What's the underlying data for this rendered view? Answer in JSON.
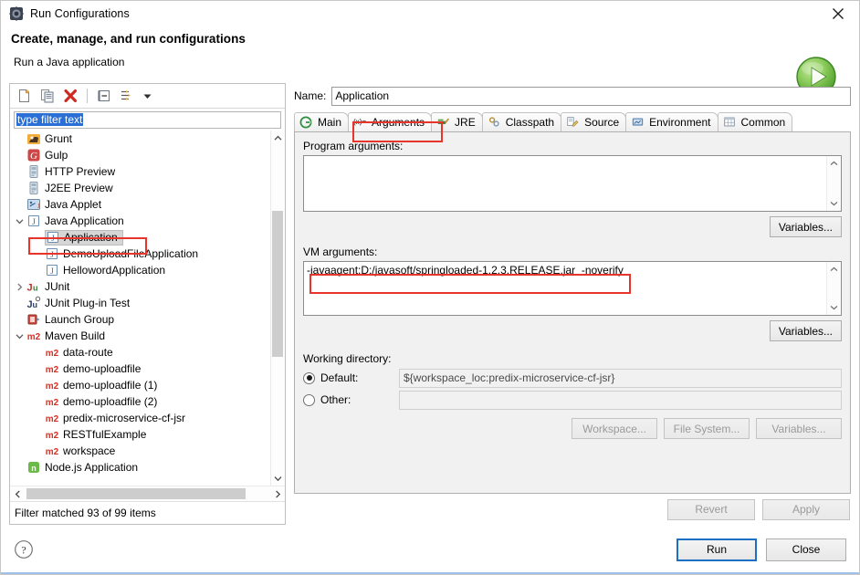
{
  "window": {
    "title": "Run Configurations",
    "app_icon": "run-configurations-icon",
    "close_label": "✕"
  },
  "header": {
    "heading": "Create, manage, and run configurations",
    "subtitle": "Run a Java application",
    "badge_icon": "green-run-icon"
  },
  "tree_toolbar": {
    "buttons": [
      {
        "name": "new-launch-configuration",
        "icon": "new-document-icon",
        "tooltip": "New launch configuration"
      },
      {
        "name": "duplicate-configuration",
        "icon": "copy-icon",
        "tooltip": "Duplicate currently selected launch configuration"
      },
      {
        "name": "delete-configuration",
        "icon": "red-x-icon",
        "tooltip": "Delete selected launch configuration(s)"
      },
      {
        "name": "collapse-all",
        "icon": "collapse-all-icon",
        "tooltip": "Collapse All"
      },
      {
        "name": "filter-configurations",
        "icon": "filter-icon",
        "tooltip": "Filter launch configurations"
      },
      {
        "name": "view-menu",
        "icon": "chevron-down-icon",
        "tooltip": "View Menu"
      }
    ]
  },
  "filter": {
    "value": "type filter text",
    "placeholder": "type filter text",
    "selected": true,
    "status": "Filter matched 93 of 99 items"
  },
  "tree": {
    "items": [
      {
        "label": "Grunt",
        "icon": "grunt-icon",
        "indent": 0,
        "twisty": "",
        "selected": false
      },
      {
        "label": "Gulp",
        "icon": "gulp-icon",
        "indent": 0,
        "twisty": "",
        "selected": false
      },
      {
        "label": "HTTP Preview",
        "icon": "server-icon",
        "indent": 0,
        "twisty": "",
        "selected": false
      },
      {
        "label": "J2EE Preview",
        "icon": "server-icon",
        "indent": 0,
        "twisty": "",
        "selected": false
      },
      {
        "label": "Java Applet",
        "icon": "java-applet-icon",
        "indent": 0,
        "twisty": "",
        "selected": false
      },
      {
        "label": "Java Application",
        "icon": "java-app-icon",
        "indent": 0,
        "twisty": "down",
        "selected": false
      },
      {
        "label": "Application",
        "icon": "java-app-icon",
        "indent": 1,
        "twisty": "",
        "selected": true
      },
      {
        "label": "DemoUploadFileApplication",
        "icon": "java-app-icon",
        "indent": 1,
        "twisty": "",
        "selected": false
      },
      {
        "label": "HellowordApplication",
        "icon": "java-app-icon",
        "indent": 1,
        "twisty": "",
        "selected": false
      },
      {
        "label": "JUnit",
        "icon": "junit-icon",
        "indent": 0,
        "twisty": "right",
        "selected": false
      },
      {
        "label": "JUnit Plug-in Test",
        "icon": "junit-plugin-icon",
        "indent": 0,
        "twisty": "",
        "selected": false
      },
      {
        "label": "Launch Group",
        "icon": "launch-group-icon",
        "indent": 0,
        "twisty": "",
        "selected": false
      },
      {
        "label": "Maven Build",
        "icon": "maven-icon",
        "indent": 0,
        "twisty": "down",
        "selected": false
      },
      {
        "label": "data-route",
        "icon": "maven-icon",
        "indent": 1,
        "twisty": "",
        "selected": false
      },
      {
        "label": "demo-uploadfile",
        "icon": "maven-icon",
        "indent": 1,
        "twisty": "",
        "selected": false
      },
      {
        "label": "demo-uploadfile (1)",
        "icon": "maven-icon",
        "indent": 1,
        "twisty": "",
        "selected": false
      },
      {
        "label": "demo-uploadfile (2)",
        "icon": "maven-icon",
        "indent": 1,
        "twisty": "",
        "selected": false
      },
      {
        "label": "predix-microservice-cf-jsr",
        "icon": "maven-icon",
        "indent": 1,
        "twisty": "",
        "selected": false
      },
      {
        "label": "RESTfulExample",
        "icon": "maven-icon",
        "indent": 1,
        "twisty": "",
        "selected": false
      },
      {
        "label": "workspace",
        "icon": "maven-icon",
        "indent": 1,
        "twisty": "",
        "selected": false
      },
      {
        "label": "Node.js Application",
        "icon": "nodejs-icon",
        "indent": 0,
        "twisty": "",
        "selected": false
      }
    ]
  },
  "config": {
    "name_label": "Name:",
    "name_value": "Application"
  },
  "tabs": [
    {
      "label": "Main",
      "icon": "main-tab-icon",
      "active": false
    },
    {
      "label": "Arguments",
      "icon": "arguments-tab-icon",
      "active": true
    },
    {
      "label": "JRE",
      "icon": "jre-tab-icon",
      "active": false
    },
    {
      "label": "Classpath",
      "icon": "classpath-tab-icon",
      "active": false
    },
    {
      "label": "Source",
      "icon": "source-tab-icon",
      "active": false
    },
    {
      "label": "Environment",
      "icon": "environment-tab-icon",
      "active": false
    },
    {
      "label": "Common",
      "icon": "common-tab-icon",
      "active": false
    }
  ],
  "arguments_tab": {
    "program_args": {
      "label": "Program arguments:",
      "value": "",
      "variables_button": "Variables..."
    },
    "vm_args": {
      "label": "VM arguments:",
      "value": "-javaagent:D:/javasoft/springloaded-1.2.3.RELEASE.jar  -noverify",
      "variables_button": "Variables..."
    },
    "working_directory": {
      "label": "Working directory:",
      "default_label": "Default:",
      "default_value": "${workspace_loc:predix-microservice-cf-jsr}",
      "default_selected": true,
      "other_label": "Other:",
      "other_value": "",
      "other_selected": false,
      "buttons": [
        {
          "label": "Workspace...",
          "name": "workspace-button",
          "disabled": true
        },
        {
          "label": "File System...",
          "name": "file-system-button",
          "disabled": true
        },
        {
          "label": "Variables...",
          "name": "wd-variables-button",
          "disabled": true
        }
      ]
    }
  },
  "action_bar": {
    "revert": "Revert",
    "apply": "Apply",
    "revert_disabled": true,
    "apply_disabled": true
  },
  "footer": {
    "help_icon": "help-question-icon",
    "run": "Run",
    "close": "Close",
    "run_is_default": true
  },
  "colors": {
    "annotation_red": "#e8342a",
    "selection_blue": "#2a6fd6",
    "focus_blue": "#1c70c4",
    "maven_red": "#d93025",
    "run_green": "#5cb53c"
  }
}
